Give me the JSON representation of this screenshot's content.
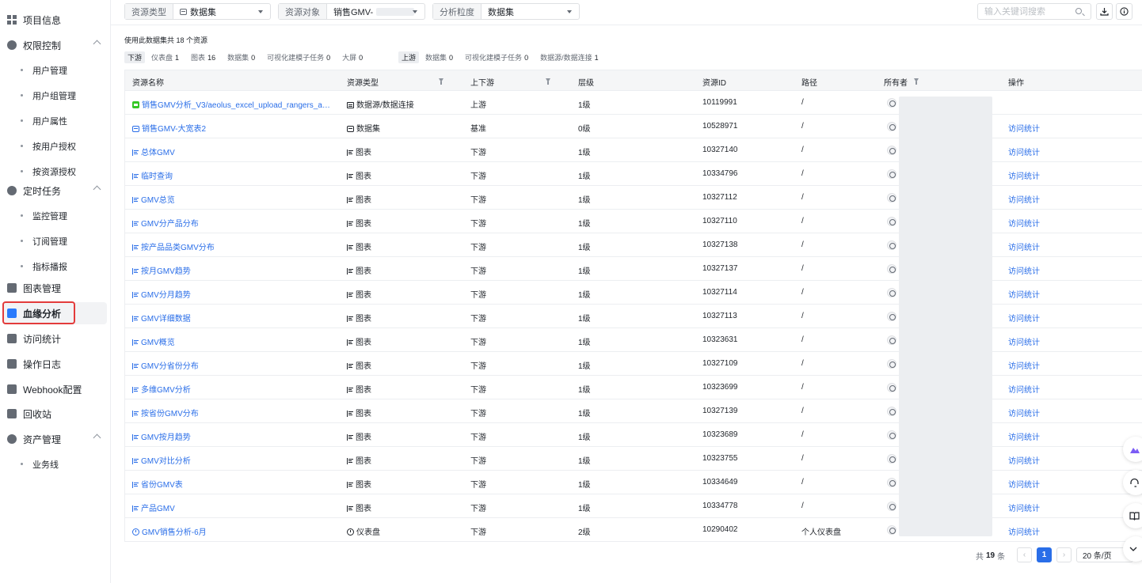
{
  "colors": {
    "accent": "#2a6ee8",
    "highlight": "#e33b3b",
    "active_icon": "#2a7afc"
  },
  "sidebar": {
    "items": [
      {
        "label": "项目信息",
        "icon": "grid-icon"
      },
      {
        "label": "权限控制",
        "icon": "shield-icon",
        "expanded": true
      },
      {
        "label": "用户管理",
        "sub": true
      },
      {
        "label": "用户组管理",
        "sub": true
      },
      {
        "label": "用户属性",
        "sub": true
      },
      {
        "label": "按用户授权",
        "sub": true
      },
      {
        "label": "按资源授权",
        "sub": true
      },
      {
        "label": "定时任务",
        "icon": "clock-icon",
        "expanded": true
      },
      {
        "label": "监控管理",
        "sub": true
      },
      {
        "label": "订阅管理",
        "sub": true
      },
      {
        "label": "指标播报",
        "sub": true
      },
      {
        "label": "图表管理",
        "icon": "chart-icon"
      },
      {
        "label": "血缘分析",
        "icon": "lineage-icon",
        "active": true
      },
      {
        "label": "访问统计",
        "icon": "stats-icon"
      },
      {
        "label": "操作日志",
        "icon": "log-icon"
      },
      {
        "label": "Webhook配置",
        "icon": "webhook-icon"
      },
      {
        "label": "回收站",
        "icon": "trash-icon"
      },
      {
        "label": "资产管理",
        "icon": "asset-icon",
        "expanded": true
      },
      {
        "label": "业务线",
        "sub": true
      }
    ]
  },
  "filters": {
    "resource_type": {
      "label": "资源类型",
      "value": "数据集"
    },
    "resource_object": {
      "label": "资源对象",
      "value": "销售GMV-"
    },
    "granularity": {
      "label": "分析粒度",
      "value": "数据集"
    }
  },
  "search": {
    "placeholder": "输入关键词搜索"
  },
  "summary": {
    "text": "使用此数据集共 18 个资源",
    "downstream_tag": "下游",
    "downstream": [
      {
        "label": "仪表盘",
        "count": "1"
      },
      {
        "label": "图表",
        "count": "16"
      },
      {
        "label": "数据集",
        "count": "0"
      },
      {
        "label": "可视化建模子任务",
        "count": "0"
      },
      {
        "label": "大屏",
        "count": "0"
      }
    ],
    "upstream_tag": "上游",
    "upstream": [
      {
        "label": "数据集",
        "count": "0"
      },
      {
        "label": "可视化建模子任务",
        "count": "0"
      },
      {
        "label": "数据源/数据连接",
        "count": "1"
      }
    ]
  },
  "table": {
    "headers": {
      "name": "资源名称",
      "type": "资源类型",
      "direction": "上下游",
      "level": "层级",
      "id": "资源ID",
      "path": "路径",
      "owner": "所有者",
      "action": "操作"
    },
    "rows": [
      {
        "name": "销售GMV分析_V3/aeolus_excel_upload_rangers_abipr...",
        "icon": "green-source",
        "type": "数据源/数据连接",
        "type_icon": "ds",
        "direction": "上游",
        "level": "1级",
        "id": "10119991",
        "path": "/",
        "action": ""
      },
      {
        "name": "销售GMV-大宽表2",
        "icon": "db",
        "type": "数据集",
        "type_icon": "db",
        "direction": "基准",
        "level": "0级",
        "id": "10528971",
        "path": "/",
        "action": "访问统计"
      },
      {
        "name": "总体GMV",
        "icon": "chart",
        "type": "图表",
        "type_icon": "chart",
        "direction": "下游",
        "level": "1级",
        "id": "10327140",
        "path": "/",
        "action": "访问统计"
      },
      {
        "name": "临时查询",
        "icon": "chart",
        "type": "图表",
        "type_icon": "chart",
        "direction": "下游",
        "level": "1级",
        "id": "10334796",
        "path": "/",
        "action": "访问统计"
      },
      {
        "name": "GMV总览",
        "icon": "chart",
        "type": "图表",
        "type_icon": "chart",
        "direction": "下游",
        "level": "1级",
        "id": "10327112",
        "path": "/",
        "action": "访问统计"
      },
      {
        "name": "GMV分产品分布",
        "icon": "chart",
        "type": "图表",
        "type_icon": "chart",
        "direction": "下游",
        "level": "1级",
        "id": "10327110",
        "path": "/",
        "action": "访问统计"
      },
      {
        "name": "按产品品类GMV分布",
        "icon": "chart",
        "type": "图表",
        "type_icon": "chart",
        "direction": "下游",
        "level": "1级",
        "id": "10327138",
        "path": "/",
        "action": "访问统计"
      },
      {
        "name": "按月GMV趋势",
        "icon": "chart",
        "type": "图表",
        "type_icon": "chart",
        "direction": "下游",
        "level": "1级",
        "id": "10327137",
        "path": "/",
        "action": "访问统计"
      },
      {
        "name": "GMV分月趋势",
        "icon": "chart",
        "type": "图表",
        "type_icon": "chart",
        "direction": "下游",
        "level": "1级",
        "id": "10327114",
        "path": "/",
        "action": "访问统计"
      },
      {
        "name": "GMV详细数据",
        "icon": "chart",
        "type": "图表",
        "type_icon": "chart",
        "direction": "下游",
        "level": "1级",
        "id": "10327113",
        "path": "/",
        "action": "访问统计"
      },
      {
        "name": "GMV概览",
        "icon": "chart",
        "type": "图表",
        "type_icon": "chart",
        "direction": "下游",
        "level": "1级",
        "id": "10323631",
        "path": "/",
        "action": "访问统计"
      },
      {
        "name": "GMV分省份分布",
        "icon": "chart",
        "type": "图表",
        "type_icon": "chart",
        "direction": "下游",
        "level": "1级",
        "id": "10327109",
        "path": "/",
        "action": "访问统计"
      },
      {
        "name": "多维GMV分析",
        "icon": "chart",
        "type": "图表",
        "type_icon": "chart",
        "direction": "下游",
        "level": "1级",
        "id": "10323699",
        "path": "/",
        "action": "访问统计"
      },
      {
        "name": "按省份GMV分布",
        "icon": "chart",
        "type": "图表",
        "type_icon": "chart",
        "direction": "下游",
        "level": "1级",
        "id": "10327139",
        "path": "/",
        "action": "访问统计"
      },
      {
        "name": "GMV按月趋势",
        "icon": "chart",
        "type": "图表",
        "type_icon": "chart",
        "direction": "下游",
        "level": "1级",
        "id": "10323689",
        "path": "/",
        "action": "访问统计"
      },
      {
        "name": "GMV对比分析",
        "icon": "chart",
        "type": "图表",
        "type_icon": "chart",
        "direction": "下游",
        "level": "1级",
        "id": "10323755",
        "path": "/",
        "action": "访问统计"
      },
      {
        "name": "省份GMV表",
        "icon": "chart",
        "type": "图表",
        "type_icon": "chart",
        "direction": "下游",
        "level": "1级",
        "id": "10334649",
        "path": "/",
        "action": "访问统计"
      },
      {
        "name": "产品GMV",
        "icon": "chart",
        "type": "图表",
        "type_icon": "chart",
        "direction": "下游",
        "level": "1级",
        "id": "10334778",
        "path": "/",
        "action": "访问统计"
      },
      {
        "name": "GMV销售分析-6月",
        "icon": "dash",
        "type": "仪表盘",
        "type_icon": "dash",
        "direction": "下游",
        "level": "2级",
        "id": "10290402",
        "path": "个人仪表盘",
        "action": "访问统计"
      }
    ]
  },
  "pagination": {
    "total_prefix": "共",
    "total": "19",
    "total_suffix": "条",
    "current_page": "1",
    "page_size": "20 条/页"
  }
}
